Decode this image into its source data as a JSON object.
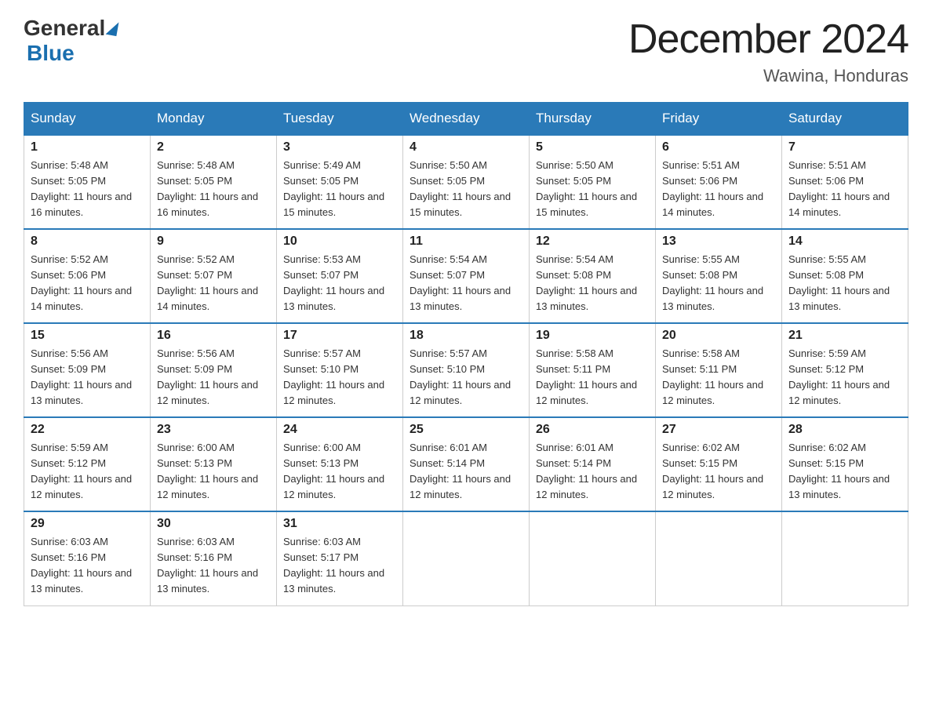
{
  "header": {
    "logo_general": "General",
    "logo_blue": "Blue",
    "title": "December 2024",
    "subtitle": "Wawina, Honduras"
  },
  "weekdays": [
    "Sunday",
    "Monday",
    "Tuesday",
    "Wednesday",
    "Thursday",
    "Friday",
    "Saturday"
  ],
  "weeks": [
    [
      {
        "day": "1",
        "sunrise": "5:48 AM",
        "sunset": "5:05 PM",
        "daylight": "11 hours and 16 minutes."
      },
      {
        "day": "2",
        "sunrise": "5:48 AM",
        "sunset": "5:05 PM",
        "daylight": "11 hours and 16 minutes."
      },
      {
        "day": "3",
        "sunrise": "5:49 AM",
        "sunset": "5:05 PM",
        "daylight": "11 hours and 15 minutes."
      },
      {
        "day": "4",
        "sunrise": "5:50 AM",
        "sunset": "5:05 PM",
        "daylight": "11 hours and 15 minutes."
      },
      {
        "day": "5",
        "sunrise": "5:50 AM",
        "sunset": "5:05 PM",
        "daylight": "11 hours and 15 minutes."
      },
      {
        "day": "6",
        "sunrise": "5:51 AM",
        "sunset": "5:06 PM",
        "daylight": "11 hours and 14 minutes."
      },
      {
        "day": "7",
        "sunrise": "5:51 AM",
        "sunset": "5:06 PM",
        "daylight": "11 hours and 14 minutes."
      }
    ],
    [
      {
        "day": "8",
        "sunrise": "5:52 AM",
        "sunset": "5:06 PM",
        "daylight": "11 hours and 14 minutes."
      },
      {
        "day": "9",
        "sunrise": "5:52 AM",
        "sunset": "5:07 PM",
        "daylight": "11 hours and 14 minutes."
      },
      {
        "day": "10",
        "sunrise": "5:53 AM",
        "sunset": "5:07 PM",
        "daylight": "11 hours and 13 minutes."
      },
      {
        "day": "11",
        "sunrise": "5:54 AM",
        "sunset": "5:07 PM",
        "daylight": "11 hours and 13 minutes."
      },
      {
        "day": "12",
        "sunrise": "5:54 AM",
        "sunset": "5:08 PM",
        "daylight": "11 hours and 13 minutes."
      },
      {
        "day": "13",
        "sunrise": "5:55 AM",
        "sunset": "5:08 PM",
        "daylight": "11 hours and 13 minutes."
      },
      {
        "day": "14",
        "sunrise": "5:55 AM",
        "sunset": "5:08 PM",
        "daylight": "11 hours and 13 minutes."
      }
    ],
    [
      {
        "day": "15",
        "sunrise": "5:56 AM",
        "sunset": "5:09 PM",
        "daylight": "11 hours and 13 minutes."
      },
      {
        "day": "16",
        "sunrise": "5:56 AM",
        "sunset": "5:09 PM",
        "daylight": "11 hours and 12 minutes."
      },
      {
        "day": "17",
        "sunrise": "5:57 AM",
        "sunset": "5:10 PM",
        "daylight": "11 hours and 12 minutes."
      },
      {
        "day": "18",
        "sunrise": "5:57 AM",
        "sunset": "5:10 PM",
        "daylight": "11 hours and 12 minutes."
      },
      {
        "day": "19",
        "sunrise": "5:58 AM",
        "sunset": "5:11 PM",
        "daylight": "11 hours and 12 minutes."
      },
      {
        "day": "20",
        "sunrise": "5:58 AM",
        "sunset": "5:11 PM",
        "daylight": "11 hours and 12 minutes."
      },
      {
        "day": "21",
        "sunrise": "5:59 AM",
        "sunset": "5:12 PM",
        "daylight": "11 hours and 12 minutes."
      }
    ],
    [
      {
        "day": "22",
        "sunrise": "5:59 AM",
        "sunset": "5:12 PM",
        "daylight": "11 hours and 12 minutes."
      },
      {
        "day": "23",
        "sunrise": "6:00 AM",
        "sunset": "5:13 PM",
        "daylight": "11 hours and 12 minutes."
      },
      {
        "day": "24",
        "sunrise": "6:00 AM",
        "sunset": "5:13 PM",
        "daylight": "11 hours and 12 minutes."
      },
      {
        "day": "25",
        "sunrise": "6:01 AM",
        "sunset": "5:14 PM",
        "daylight": "11 hours and 12 minutes."
      },
      {
        "day": "26",
        "sunrise": "6:01 AM",
        "sunset": "5:14 PM",
        "daylight": "11 hours and 12 minutes."
      },
      {
        "day": "27",
        "sunrise": "6:02 AM",
        "sunset": "5:15 PM",
        "daylight": "11 hours and 12 minutes."
      },
      {
        "day": "28",
        "sunrise": "6:02 AM",
        "sunset": "5:15 PM",
        "daylight": "11 hours and 13 minutes."
      }
    ],
    [
      {
        "day": "29",
        "sunrise": "6:03 AM",
        "sunset": "5:16 PM",
        "daylight": "11 hours and 13 minutes."
      },
      {
        "day": "30",
        "sunrise": "6:03 AM",
        "sunset": "5:16 PM",
        "daylight": "11 hours and 13 minutes."
      },
      {
        "day": "31",
        "sunrise": "6:03 AM",
        "sunset": "5:17 PM",
        "daylight": "11 hours and 13 minutes."
      },
      null,
      null,
      null,
      null
    ]
  ]
}
